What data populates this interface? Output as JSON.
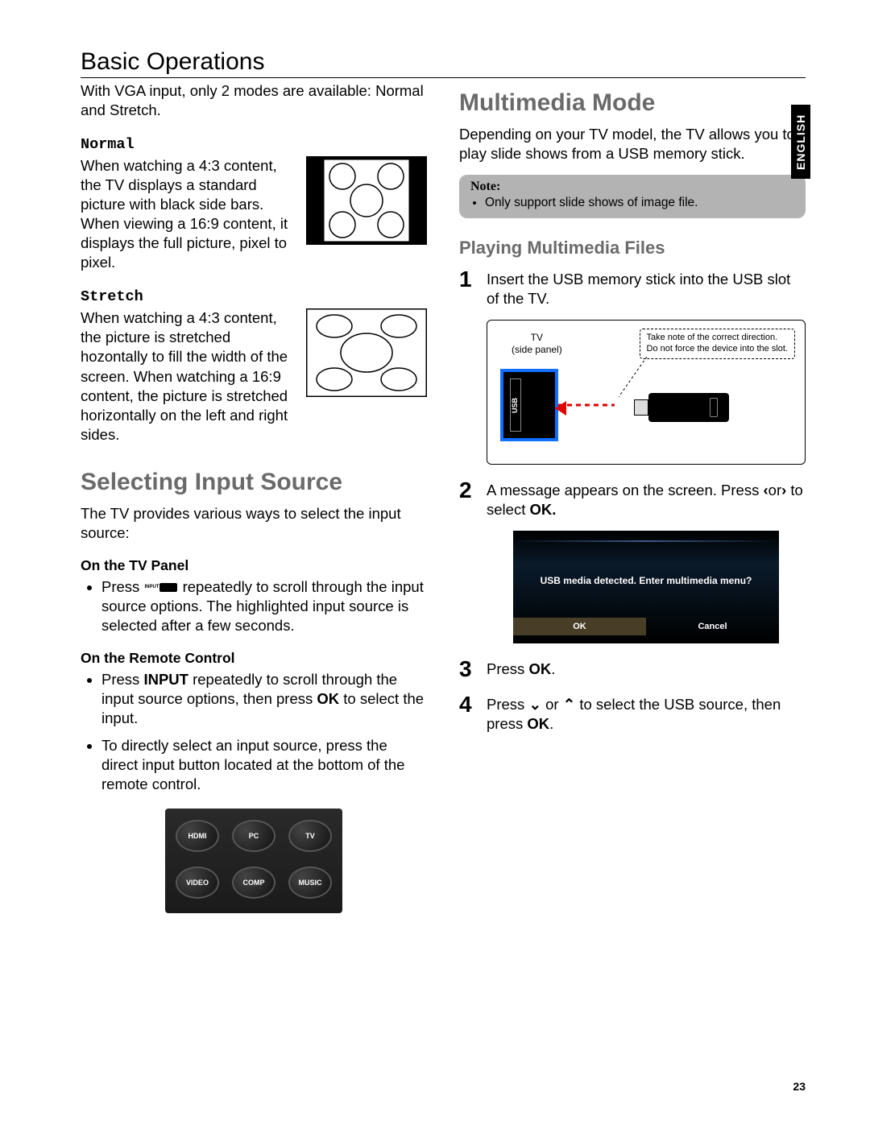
{
  "page": {
    "title": "Basic Operations",
    "language_tab": "ENGLISH",
    "number": "23"
  },
  "left": {
    "intro": "With VGA input, only 2 modes are available: Normal and Stretch.",
    "normal": {
      "heading": "Normal",
      "body": "When watching a 4:3 content, the TV displays a standard picture with black side bars. When viewing a 16:9 content, it displays the full picture, pixel to pixel."
    },
    "stretch": {
      "heading": "Stretch",
      "body": "When watching a 4:3 content, the picture is stretched hozontally to fill the width of the screen. When watching a 16:9 content, the picture is stretched horizontally on the left and right sides."
    },
    "selecting": {
      "heading": "Selecting Input Source",
      "intro": "The TV provides various ways to select the input source:",
      "on_tv_panel": {
        "heading": "On the TV Panel",
        "bullet": " repeatedly to scroll through the input source options. The highlighted input source is selected after a few seconds.",
        "press_prefix": "Press ",
        "input_label": "INPUT"
      },
      "on_remote": {
        "heading": "On the Remote Control",
        "b1a": "Press ",
        "b1_input": "INPUT",
        "b1b": " repeatedly to scroll through the input source options, then press ",
        "b1_ok": "OK",
        "b1c": " to select the input.",
        "b2": "To directly select an input source, press the direct input button located at the bottom of the remote control."
      },
      "remote_buttons": [
        "HDMI",
        "PC",
        "TV",
        "VIDEO",
        "COMP",
        "MUSIC"
      ]
    }
  },
  "right": {
    "multimedia": {
      "heading": "Multimedia Mode",
      "intro": "Depending on your TV model, the TV allows you to play slide shows from a USB memory stick.",
      "note_label": "Note:",
      "note_item": "Only support slide shows of image file."
    },
    "playing": {
      "heading": "Playing Multimedia Files",
      "step1": "Insert the USB memory stick into the USB slot of the TV.",
      "usb": {
        "tv_label": "TV",
        "side_panel": "(side panel)",
        "callout1": "Take note of the correct direction.",
        "callout2": "Do not force the device into the slot.",
        "port_label": "USB"
      },
      "step2a": "A message appears on the screen. Press ",
      "step2_or": "or",
      "step2b": " to select ",
      "step2_ok": "OK.",
      "dialog": {
        "message": "USB media detected. Enter multimedia menu?",
        "ok": "OK",
        "cancel": "Cancel"
      },
      "step3a": "Press ",
      "step3_ok": "OK",
      "step3b": ".",
      "step4a": "Press ",
      "step4_or": " or ",
      "step4b": " to select the USB source, then press ",
      "step4_ok": "OK",
      "step4c": "."
    }
  }
}
